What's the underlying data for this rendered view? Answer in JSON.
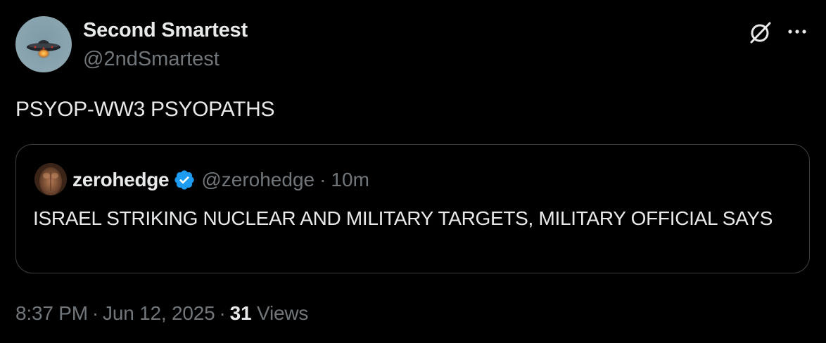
{
  "author": {
    "display_name": "Second Smartest",
    "handle": "@2ndSmartest",
    "avatar_icon": "ufo-avatar"
  },
  "tweet": {
    "text": "PSYOP-WW3 PSYOPATHS"
  },
  "quote": {
    "name": "zerohedge",
    "handle": "@zerohedge",
    "separator": "·",
    "time": "10m",
    "verified": true,
    "text": "ISRAEL STRIKING NUCLEAR AND MILITARY TARGETS, MILITARY OFFICIAL SAYS"
  },
  "meta": {
    "time": "8:37 PM",
    "date": "Jun 12, 2025",
    "separator": "·",
    "views_count": "31",
    "views_label": "Views"
  },
  "icons": {
    "grok": "grok-icon",
    "more": "more-icon",
    "verified": "verified-badge-icon"
  },
  "colors": {
    "background": "#000000",
    "text_primary": "#e7e9ea",
    "text_secondary": "#71767b",
    "border": "#3e4144",
    "verified_blue": "#1d9bf0"
  }
}
